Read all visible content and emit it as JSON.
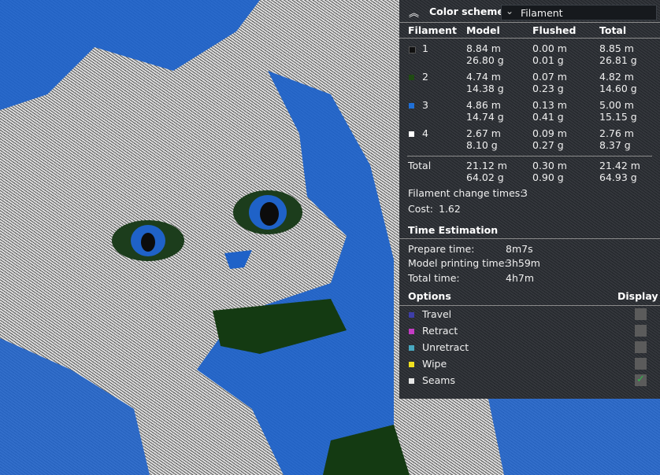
{
  "header": {
    "title": "Color scheme",
    "selected_scheme": "Filament"
  },
  "table": {
    "headers": [
      "Filament",
      "Model",
      "Flushed",
      "Total"
    ],
    "rows": [
      {
        "id": "1",
        "color": "#111111",
        "model_m": "8.84 m",
        "model_g": "26.80 g",
        "flushed_m": "0.00 m",
        "flushed_g": "0.01 g",
        "total_m": "8.85 m",
        "total_g": "26.81 g"
      },
      {
        "id": "2",
        "color": "#1f4a12",
        "model_m": "4.74 m",
        "model_g": "14.38 g",
        "flushed_m": "0.07 m",
        "flushed_g": "0.23 g",
        "total_m": "4.82 m",
        "total_g": "14.60 g"
      },
      {
        "id": "3",
        "color": "#1f6fd6",
        "model_m": "4.86 m",
        "model_g": "14.74 g",
        "flushed_m": "0.13 m",
        "flushed_g": "0.41 g",
        "total_m": "5.00 m",
        "total_g": "15.15 g"
      },
      {
        "id": "4",
        "color": "#ffffff",
        "model_m": "2.67 m",
        "model_g": "8.10 g",
        "flushed_m": "0.09 m",
        "flushed_g": "0.27 g",
        "total_m": "2.76 m",
        "total_g": "8.37 g"
      }
    ],
    "total": {
      "label": "Total",
      "model_m": "21.12 m",
      "model_g": "64.02 g",
      "flushed_m": "0.30 m",
      "flushed_g": "0.90 g",
      "total_m": "21.42 m",
      "total_g": "64.93 g"
    }
  },
  "stats": {
    "change_label": "Filament change times:",
    "change_value": "3",
    "cost_label": "Cost:",
    "cost_value": "1.62"
  },
  "time": {
    "title": "Time Estimation",
    "prepare_label": "Prepare time:",
    "prepare_value": "8m7s",
    "model_label": "Model printing time:",
    "model_value": "3h59m",
    "total_label": "Total time:",
    "total_value": "4h7m"
  },
  "options": {
    "title": "Options",
    "display_label": "Display",
    "items": [
      {
        "label": "Travel",
        "color": "#3e3ea8",
        "checked": false
      },
      {
        "label": "Retract",
        "color": "#c43cc4",
        "checked": false
      },
      {
        "label": "Unretract",
        "color": "#48a8c0",
        "checked": false
      },
      {
        "label": "Wipe",
        "color": "#f0e020",
        "checked": false
      },
      {
        "label": "Seams",
        "color": "#e6e6e6",
        "checked": true
      }
    ],
    "check_glyph": "✓"
  }
}
